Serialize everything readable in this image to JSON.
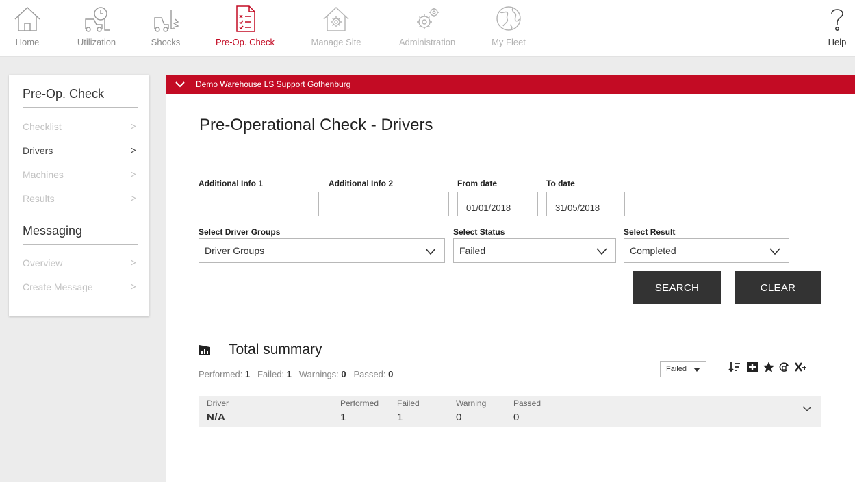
{
  "nav": {
    "items": [
      {
        "label": "Home",
        "icon": "home-icon"
      },
      {
        "label": "Utilization",
        "icon": "forklift-clock-icon"
      },
      {
        "label": "Shocks",
        "icon": "forklift-shock-icon"
      },
      {
        "label": "Pre-Op. Check",
        "icon": "checklist-icon"
      },
      {
        "label": "Manage Site",
        "icon": "house-gear-icon"
      },
      {
        "label": "Administration",
        "icon": "gears-icon"
      },
      {
        "label": "My Fleet",
        "icon": "globe-icon"
      }
    ],
    "help_label": "Help",
    "active": "Pre-Op. Check"
  },
  "sidebar": {
    "heading1": "Pre-Op. Check",
    "items1": [
      {
        "label": "Checklist"
      },
      {
        "label": "Drivers"
      },
      {
        "label": "Machines"
      },
      {
        "label": "Results"
      }
    ],
    "heading2": "Messaging",
    "items2": [
      {
        "label": "Overview"
      },
      {
        "label": "Create Message"
      }
    ],
    "active": "Drivers"
  },
  "site_bar": {
    "label": "Demo Warehouse LS Support Gothenburg"
  },
  "page": {
    "title": "Pre-Operational Check - Drivers"
  },
  "filters": {
    "additional_info_1": {
      "label": "Additional Info 1",
      "value": ""
    },
    "additional_info_2": {
      "label": "Additional Info 2",
      "value": ""
    },
    "from_date": {
      "label": "From date",
      "value": "01/01/2018"
    },
    "to_date": {
      "label": "To date",
      "value": "31/05/2018"
    },
    "driver_groups": {
      "label": "Select Driver Groups",
      "value": "Driver Groups"
    },
    "status": {
      "label": "Select Status",
      "value": "Failed"
    },
    "result": {
      "label": "Select Result",
      "value": "Completed"
    }
  },
  "buttons": {
    "search": "SEARCH",
    "clear": "CLEAR"
  },
  "summary": {
    "title": "Total summary",
    "performed_label": "Performed:",
    "performed": "1",
    "failed_label": "Failed:",
    "failed": "1",
    "warnings_label": "Warnings:",
    "warnings": "0",
    "passed_label": "Passed:",
    "passed": "0",
    "filter_value": "Failed"
  },
  "toolbar_icons": [
    "sort-icon",
    "expand-all-icon",
    "favorite-star-icon",
    "refresh-icon",
    "excel-export-icon"
  ],
  "table": {
    "columns": [
      "Driver",
      "Performed",
      "Failed",
      "Warning",
      "Passed"
    ],
    "rows": [
      {
        "driver": "N/A",
        "performed": "1",
        "failed": "1",
        "warning": "0",
        "passed": "0"
      }
    ]
  },
  "colors": {
    "accent": "#c30b24",
    "button": "#333333",
    "background": "#ececec"
  }
}
